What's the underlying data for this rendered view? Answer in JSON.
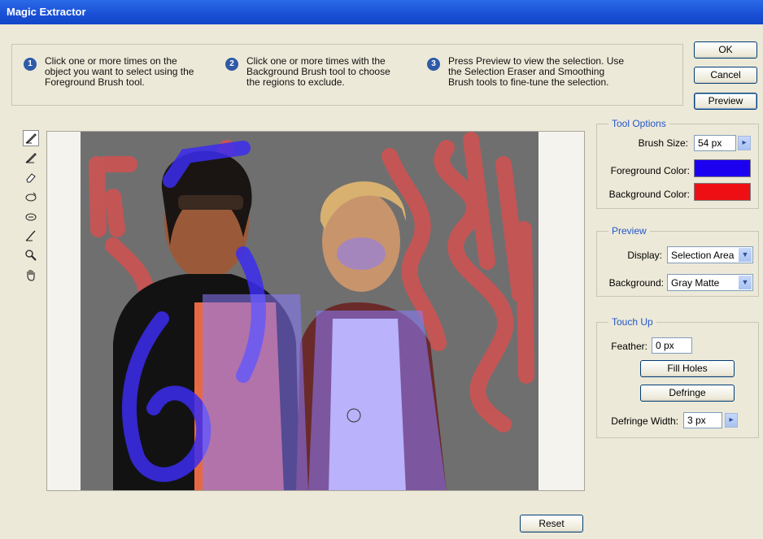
{
  "window": {
    "title": "Magic Extractor"
  },
  "instructions": [
    {
      "num": "1",
      "text": "Click one or more times on the\nobject you want to select using the\nForeground Brush tool."
    },
    {
      "num": "2",
      "text": "Click one or more times with the\nBackground Brush tool to choose\nthe regions to exclude."
    },
    {
      "num": "3",
      "text": "Press Preview to view the selection. Use\nthe Selection Eraser and Smoothing\nBrush tools to fine-tune the selection."
    }
  ],
  "buttons": {
    "ok": "OK",
    "cancel": "Cancel",
    "preview": "Preview",
    "reset": "Reset",
    "fill_holes": "Fill Holes",
    "defringe": "Defringe"
  },
  "tools": [
    {
      "name": "foreground-brush-icon",
      "glyph": "✎",
      "active": true
    },
    {
      "name": "background-brush-icon",
      "glyph": "✐",
      "active": false
    },
    {
      "name": "point-eraser-icon",
      "glyph": "⌫",
      "active": false
    },
    {
      "name": "add-to-selection-icon",
      "glyph": "⊕",
      "active": false
    },
    {
      "name": "remove-from-selection-icon",
      "glyph": "⊖",
      "active": false
    },
    {
      "name": "smoothing-brush-icon",
      "glyph": "✍",
      "active": false
    },
    {
      "name": "zoom-icon",
      "glyph": "🔍",
      "active": false
    },
    {
      "name": "hand-icon",
      "glyph": "✋",
      "active": false
    }
  ],
  "tool_options": {
    "title": "Tool Options",
    "brush_size_label": "Brush Size:",
    "brush_size_value": "54 px",
    "fg_label": "Foreground Color:",
    "fg_color": "#1c00f0",
    "bg_label": "Background Color:",
    "bg_color": "#ee0f14"
  },
  "preview": {
    "title": "Preview",
    "display_label": "Display:",
    "display_value": "Selection Area",
    "background_label": "Background:",
    "background_value": "Gray Matte"
  },
  "touch_up": {
    "title": "Touch Up",
    "feather_label": "Feather:",
    "feather_value": "0 px",
    "defringe_width_label": "Defringe Width:",
    "defringe_width_value": "3 px"
  },
  "colors": {
    "accent": "#2456c8",
    "title_bar": "#1a4fd6",
    "dialog_bg": "#ece9d8"
  }
}
